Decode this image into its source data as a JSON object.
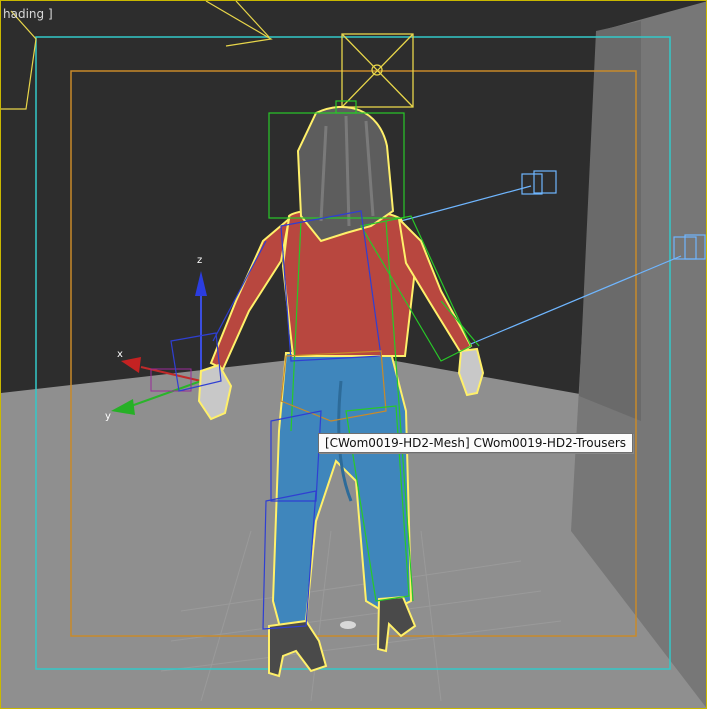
{
  "viewport": {
    "label": "hading ]",
    "tooltip": "[CWom0019-HD2-Mesh] CWom0019-HD2-Trousers"
  },
  "axis_gizmo": {
    "z_label": "z",
    "x_label": "x",
    "y_label": "y"
  },
  "colors": {
    "background_wall": "#2d2d2d",
    "floor": "#8e8e8e",
    "right_wall": "#7a7a7a",
    "safe_frame_outer": "#33c9c9",
    "safe_frame_inner": "#c88a2a",
    "selection_highlight": "#fff06a",
    "bone_green": "#28c928",
    "bone_blue": "#2f3fd2",
    "light_line": "#6fb6ff",
    "jacket": "#b8473f",
    "jeans": "#3f84b9",
    "hair": "#5a5a5a"
  }
}
